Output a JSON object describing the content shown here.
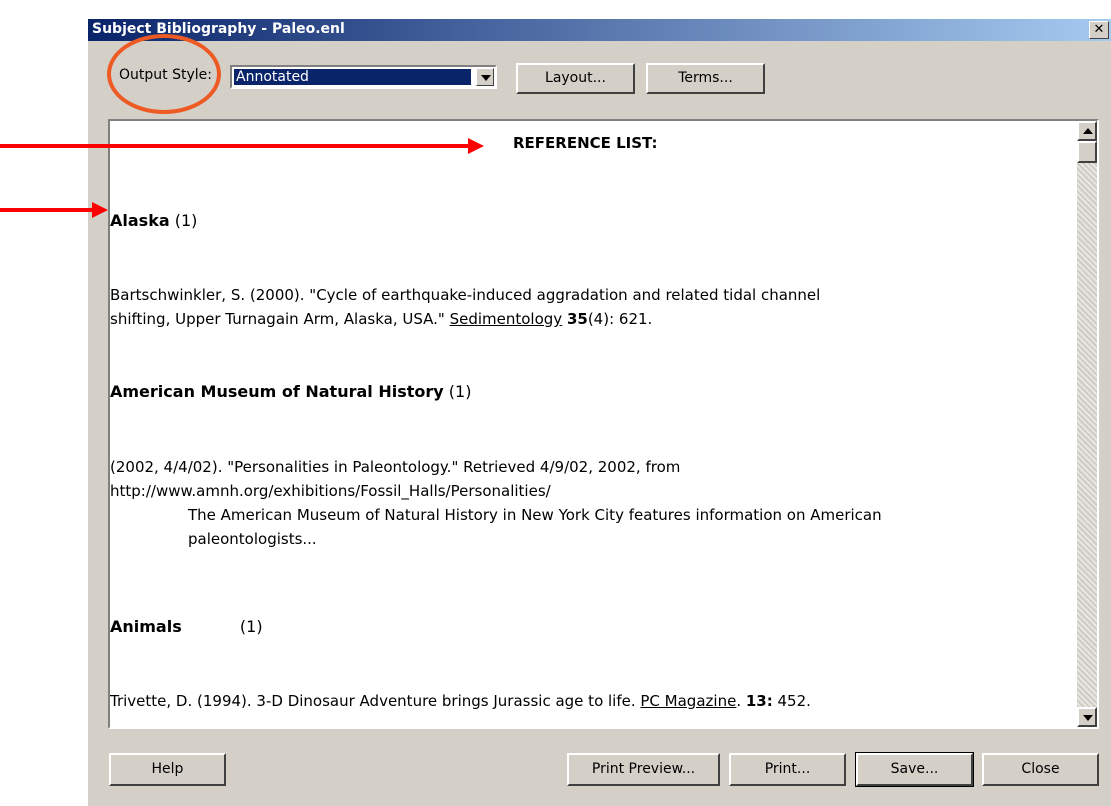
{
  "window": {
    "title": "Subject Bibliography - Paleo.enl",
    "close_glyph": "✕"
  },
  "toolbar": {
    "output_style_label": "Output Style:",
    "output_style_value": "Annotated",
    "layout_label": "Layout...",
    "terms_label": "Terms..."
  },
  "reference": {
    "header": "REFERENCE LIST:",
    "alaska": {
      "term": "Alaska",
      "count": "(1)",
      "ref_line1": "Bartschwinkler, S. (2000). \"Cycle of earthquake-induced aggradation and related tidal channel",
      "ref_line2_pre": "shifting, Upper Turnagain Arm, Alaska, USA.\" ",
      "ref_line2_journal": "Sedimentology",
      "ref_line2_vol": "35",
      "ref_line2_post": "(4): 621."
    },
    "amnh": {
      "term": "American Museum of Natural History",
      "count": "(1)",
      "ref_line1": "(2002, 4/4/02). \"Personalities in Paleontology.\"   Retrieved 4/9/02, 2002, from",
      "ref_line2": "http://www.amnh.org/exhibitions/Fossil_Halls/Personalities/",
      "note_line1": "The American Museum of Natural History in New York City features information on American",
      "note_line2": "paleontologists..."
    },
    "animals": {
      "term": "Animals",
      "count": "(1)",
      "ref_pre": "Trivette, D. (1994). 3-D Dinosaur Adventure brings Jurassic age to life. ",
      "ref_journal": "PC Magazine",
      "ref_mid": ". ",
      "ref_vol": "13:",
      "ref_post": " 452."
    }
  },
  "buttons": {
    "help": "Help",
    "print_preview": "Print Preview...",
    "print": "Print...",
    "save": "Save...",
    "close": "Close"
  },
  "colors": {
    "annotation_circle": "#ee5a24",
    "annotation_arrow": "#ff0000",
    "titlebar": "#0a246a"
  }
}
